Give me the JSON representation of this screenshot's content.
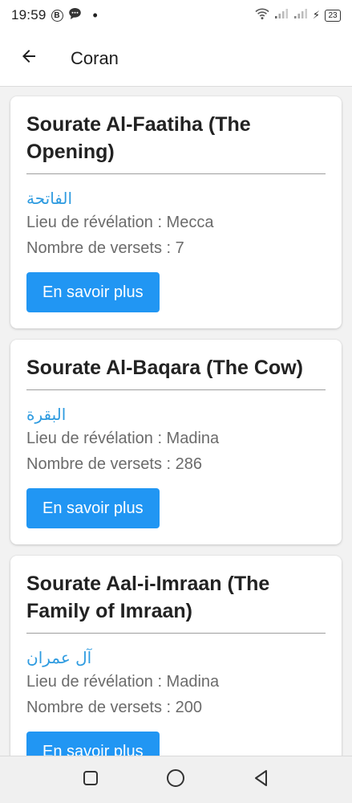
{
  "status_bar": {
    "time": "19:59",
    "b_badge": "B",
    "dot": "•",
    "battery": "23",
    "charging_glyph": "⚡"
  },
  "app_bar": {
    "title": "Coran"
  },
  "surahs": [
    {
      "title": "Sourate Al-Faatiha (The Opening)",
      "arabic": "الفاتحة",
      "revelation": "Lieu de révélation : Mecca",
      "verses": "Nombre de versets : 7",
      "button_label": "En savoir plus"
    },
    {
      "title": "Sourate Al-Baqara (The Cow)",
      "arabic": "البقرة",
      "revelation": "Lieu de révélation : Madina",
      "verses": "Nombre de versets : 286",
      "button_label": "En savoir plus"
    },
    {
      "title": "Sourate Aal-i-Imraan (The Family of Imraan)",
      "arabic": "آل عمران",
      "revelation": "Lieu de révélation : Madina",
      "verses": "Nombre de versets : 200",
      "button_label": "En savoir plus"
    }
  ],
  "colors": {
    "accent": "#2196f3",
    "arabic_text": "#2e9be0",
    "secondary_text": "#6b6b6b"
  },
  "icons": {
    "back": "arrow-left-icon",
    "nav_recents": "square-icon",
    "nav_home": "circle-icon",
    "nav_back": "triangle-back-icon"
  }
}
